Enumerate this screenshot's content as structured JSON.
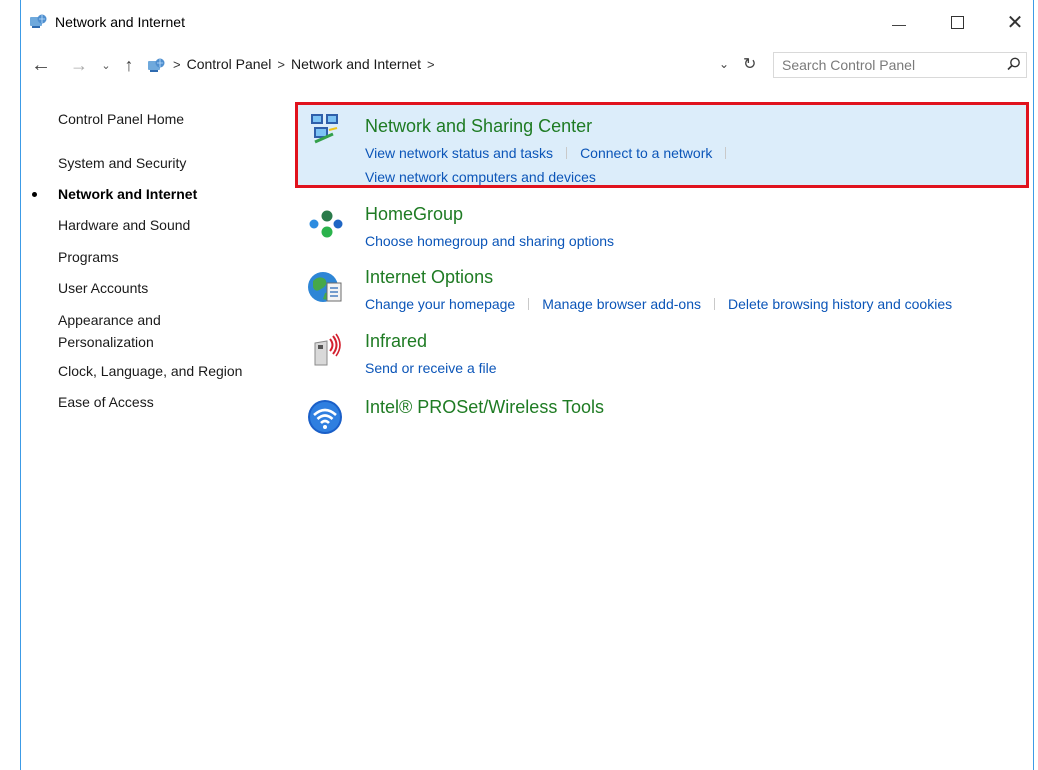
{
  "window": {
    "title": "Network and Internet"
  },
  "nav": {
    "breadcrumb": [
      "Control Panel",
      "Network and Internet"
    ],
    "search_placeholder": "Search Control Panel"
  },
  "sidebar": {
    "items": [
      {
        "label": "Control Panel Home",
        "active": false
      },
      {
        "label": "System and Security",
        "active": false
      },
      {
        "label": "Network and Internet",
        "active": true
      },
      {
        "label": "Hardware and Sound",
        "active": false
      },
      {
        "label": "Programs",
        "active": false
      },
      {
        "label": "User Accounts",
        "active": false
      },
      {
        "label": "Appearance and",
        "label2": "Personalization",
        "active": false
      },
      {
        "label": "Clock, Language, and Region",
        "active": false
      },
      {
        "label": "Ease of Access",
        "active": false
      }
    ]
  },
  "categories": [
    {
      "title": "Network and Sharing Center",
      "icon": "network-sharing-icon",
      "highlighted": true,
      "links_row1": [
        "View network status and tasks",
        "Connect to a network"
      ],
      "links_row2": [
        "View network computers and devices"
      ]
    },
    {
      "title": "HomeGroup",
      "icon": "homegroup-icon",
      "links_row1": [
        "Choose homegroup and sharing options"
      ]
    },
    {
      "title": "Internet Options",
      "icon": "internet-options-icon",
      "links_row1": [
        "Change your homepage",
        "Manage browser add-ons",
        "Delete browsing history and cookies"
      ]
    },
    {
      "title": "Infrared",
      "icon": "infrared-icon",
      "links_row1": [
        "Send or receive a file"
      ]
    },
    {
      "title": "Intel® PROSet/Wireless Tools",
      "icon": "wifi-icon",
      "links_row1": []
    }
  ],
  "colors": {
    "category_title": "#1e7b23",
    "link": "#0b55b8",
    "highlight_border": "#e0121d",
    "highlight_fill": "#dcedfa",
    "window_border": "#3c9be6"
  }
}
